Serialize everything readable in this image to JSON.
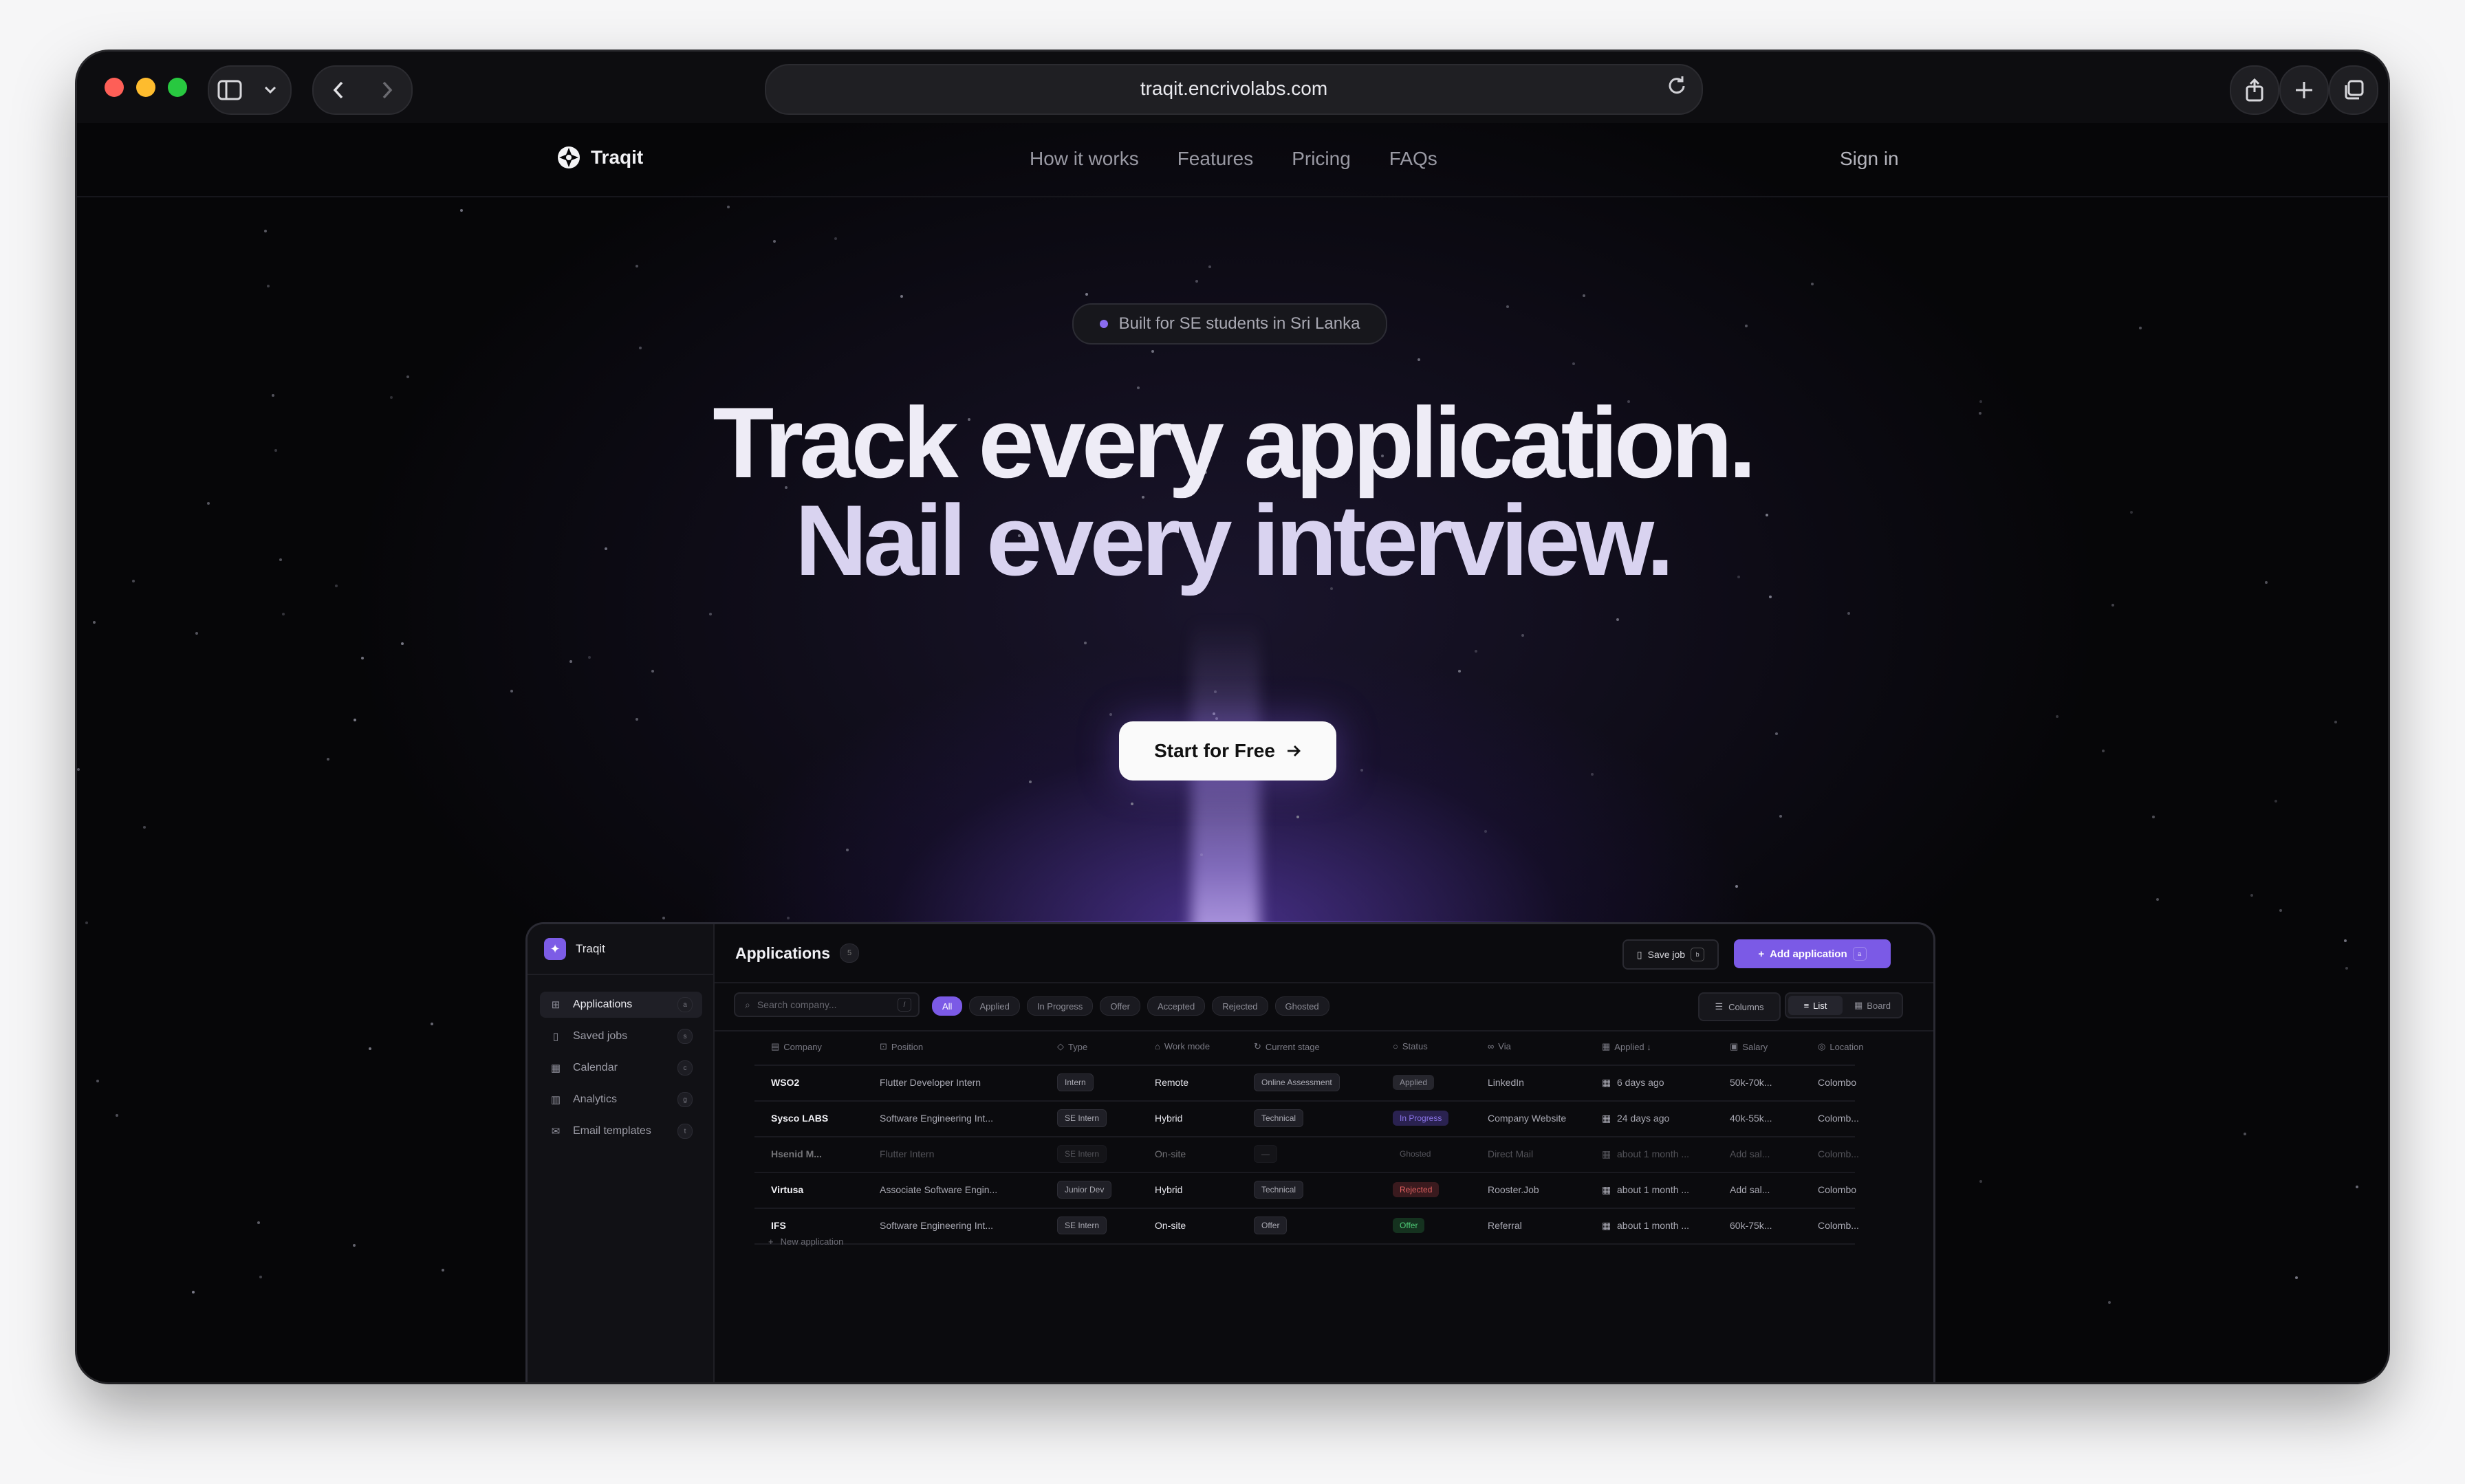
{
  "browser": {
    "url": "traqit.encrivolabs.com"
  },
  "nav": {
    "brand": "Traqit",
    "links": [
      "How it works",
      "Features",
      "Pricing",
      "FAQs"
    ],
    "signin": "Sign in"
  },
  "hero": {
    "badge": "Built for SE students in Sri Lanka",
    "headline_line1": "Track every application.",
    "headline_line2": "Nail every interview.",
    "cta": "Start for Free",
    "cta_icon": "arrow-right-icon"
  },
  "colors": {
    "accent": "#7b5ae6",
    "background": "#060608",
    "status_applied": "#8e8e98",
    "status_in_progress": "#8b74e8",
    "status_rejected": "#e26060",
    "status_offer": "#4fce78"
  },
  "app_preview": {
    "brand": "Traqit",
    "sidebar": [
      {
        "label": "Applications",
        "icon": "grid-icon",
        "key": "a",
        "active": true
      },
      {
        "label": "Saved jobs",
        "icon": "bookmark-icon",
        "key": "s",
        "active": false
      },
      {
        "label": "Calendar",
        "icon": "calendar-icon",
        "key": "c",
        "active": false
      },
      {
        "label": "Analytics",
        "icon": "chart-icon",
        "key": "g",
        "active": false
      },
      {
        "label": "Email templates",
        "icon": "mail-icon",
        "key": "t",
        "active": false
      }
    ],
    "title": "Applications",
    "count": "5",
    "save_job": "Save job",
    "save_job_key": "b",
    "add_application": "Add application",
    "add_application_key": "a",
    "search_placeholder": "Search company...",
    "search_key": "/",
    "filters": [
      "All",
      "Applied",
      "In Progress",
      "Offer",
      "Accepted",
      "Rejected",
      "Ghosted"
    ],
    "active_filter": "All",
    "columns_button": "Columns",
    "view_list": "List",
    "view_board": "Board",
    "columns": [
      "Company",
      "Position",
      "Type",
      "Work mode",
      "Current stage",
      "Status",
      "Via",
      "Applied ↓",
      "Salary",
      "Location"
    ],
    "rows": [
      {
        "company": "WSO2",
        "position": "Flutter Developer Intern",
        "type": "Intern",
        "mode": "Remote",
        "stage": "Online Assessment",
        "status": "Applied",
        "via": "LinkedIn",
        "applied": "6 days ago",
        "salary": "50k-70k...",
        "location": "Colombo",
        "faded": false
      },
      {
        "company": "Sysco LABS",
        "position": "Software Engineering Int...",
        "type": "SE Intern",
        "mode": "Hybrid",
        "stage": "Technical",
        "status": "In Progress",
        "via": "Company Website",
        "applied": "24 days ago",
        "salary": "40k-55k...",
        "location": "Colomb...",
        "faded": false
      },
      {
        "company": "Hsenid M...",
        "position": "Flutter Intern",
        "type": "SE Intern",
        "mode": "On-site",
        "stage": "—",
        "status": "Ghosted",
        "via": "Direct Mail",
        "applied": "about 1 month ...",
        "salary": "Add sal...",
        "location": "Colomb...",
        "faded": true
      },
      {
        "company": "Virtusa",
        "position": "Associate Software Engin...",
        "type": "Junior Dev",
        "mode": "Hybrid",
        "stage": "Technical",
        "status": "Rejected",
        "via": "Rooster.Job",
        "applied": "about 1 month ...",
        "salary": "Add sal...",
        "location": "Colombo",
        "faded": false
      },
      {
        "company": "IFS",
        "position": "Software Engineering Int...",
        "type": "SE Intern",
        "mode": "On-site",
        "stage": "Offer",
        "status": "Offer",
        "via": "Referral",
        "applied": "about 1 month ...",
        "salary": "60k-75k...",
        "location": "Colomb...",
        "faded": false
      }
    ],
    "new_application": "New application"
  }
}
